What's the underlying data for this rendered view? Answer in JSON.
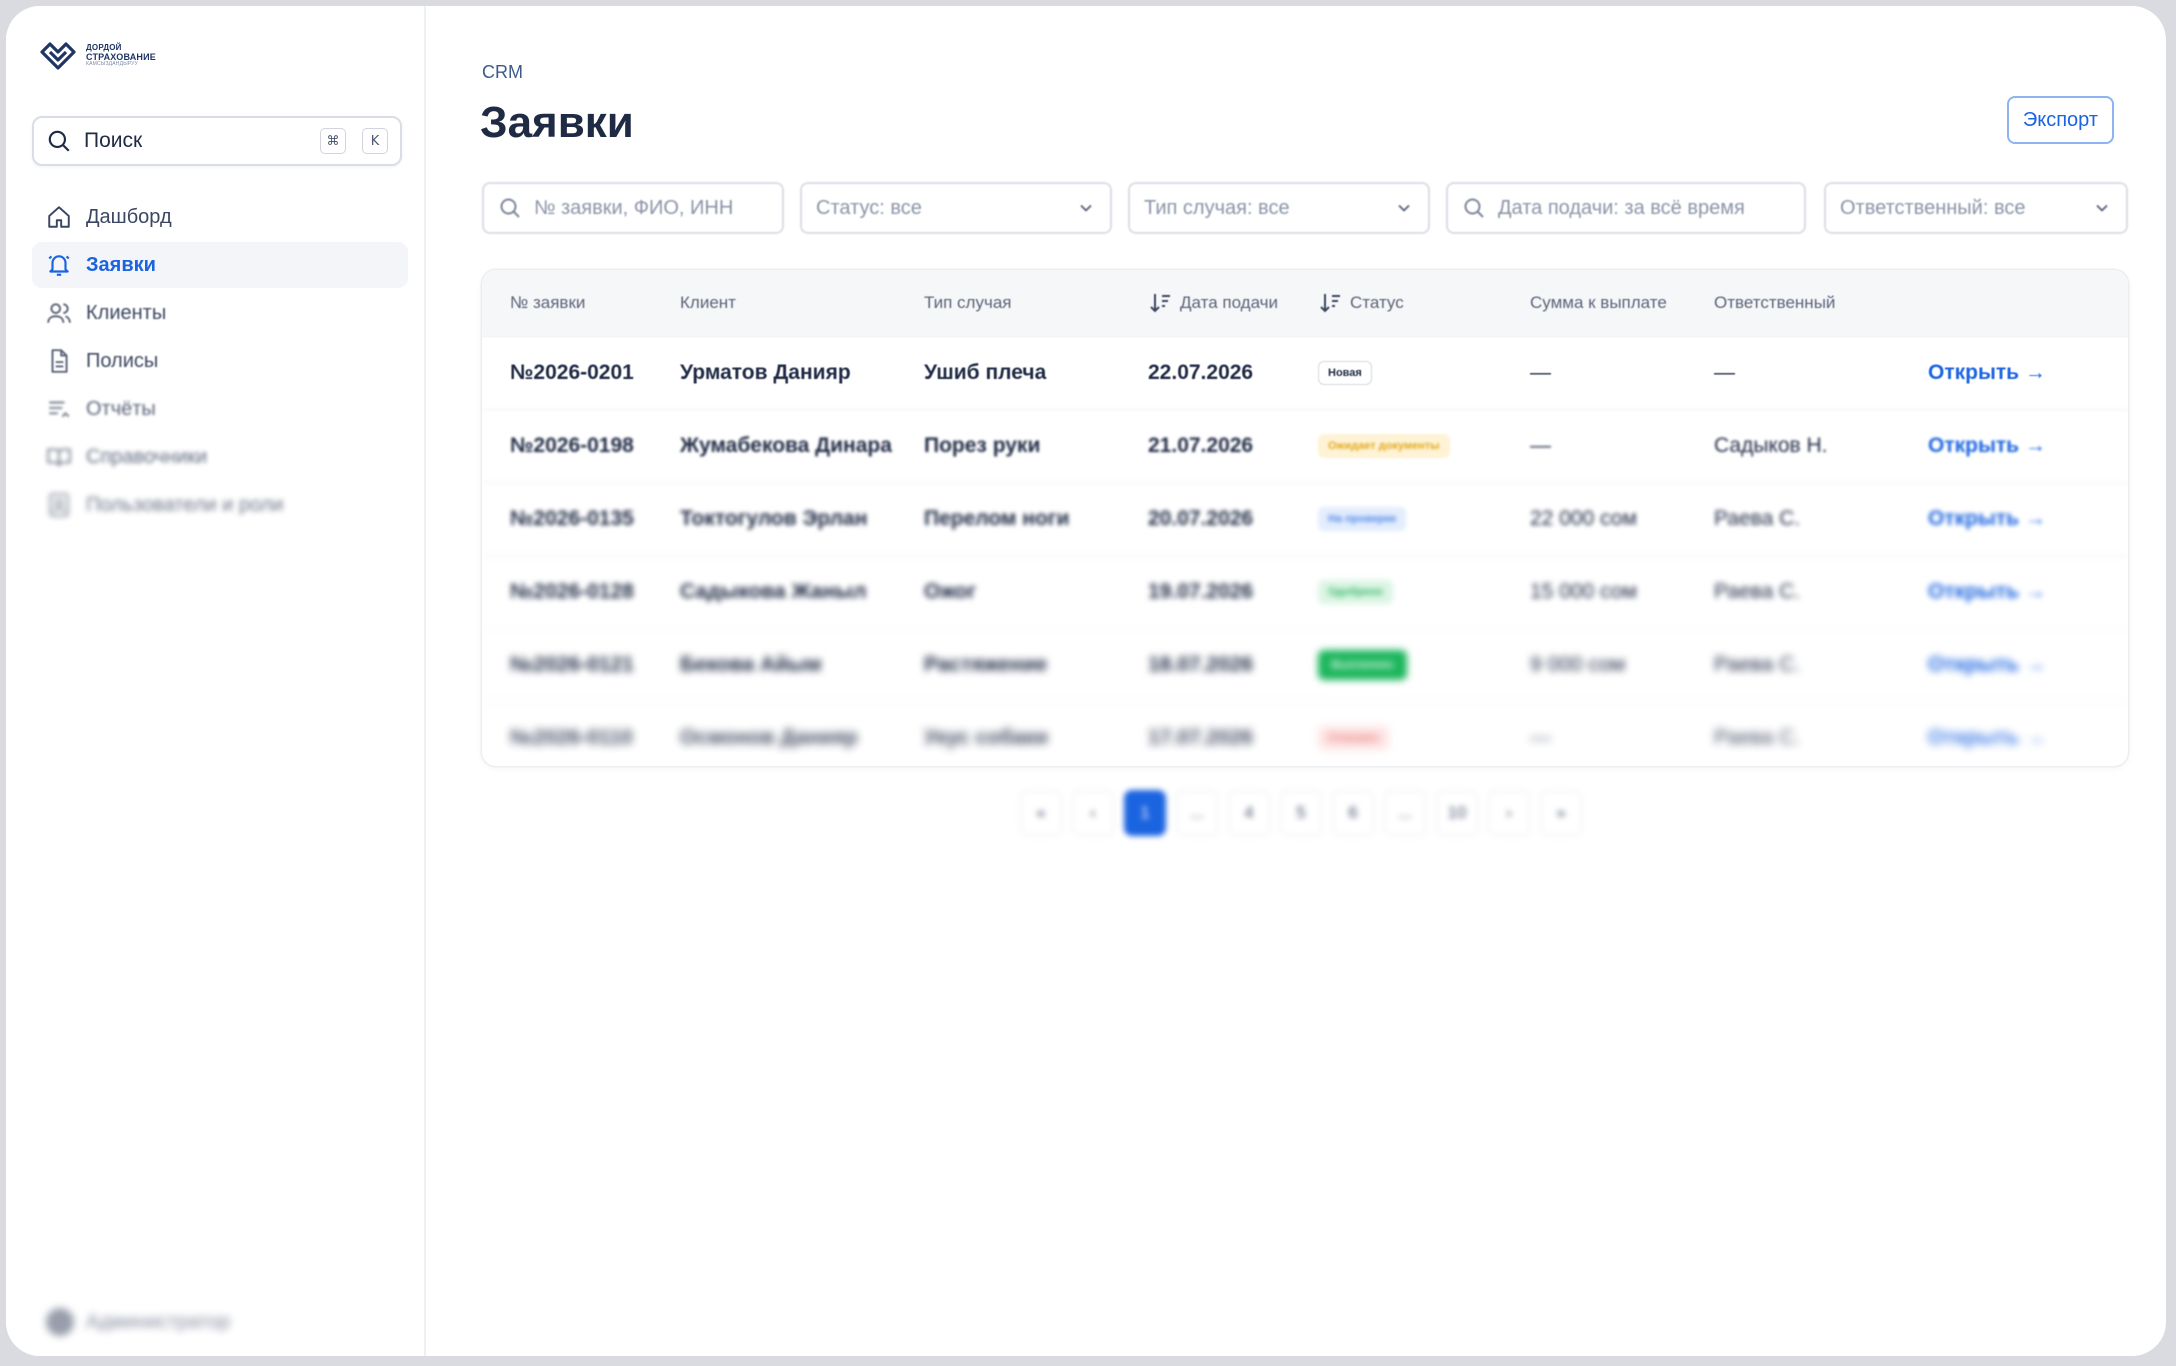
{
  "colors": {
    "accent": "#1b64e0",
    "text": "#1f2a44",
    "muted": "#8a93a6"
  },
  "brand": {
    "line1": "ДОРДОЙ",
    "line2": "СТРАХОВАНИЕ",
    "line3": "КАМСЫЗДАНДЫРУУ",
    "icon": "logo-mark-icon"
  },
  "sidebar": {
    "search": {
      "label": "Поиск",
      "kbd1": "⌘",
      "kbd2": "K"
    },
    "items": [
      {
        "label": "Дашборд",
        "icon": "home-icon"
      },
      {
        "label": "Заявки",
        "icon": "bell-icon",
        "active": true
      },
      {
        "label": "Клиенты",
        "icon": "users-icon"
      },
      {
        "label": "Полисы",
        "icon": "document-icon"
      },
      {
        "label": "Отчёты",
        "icon": "list-icon"
      },
      {
        "label": "Справочники",
        "icon": "book-icon"
      },
      {
        "label": "Пользователи и роли",
        "icon": "id-card-icon"
      }
    ],
    "user": {
      "name": "Администратор"
    }
  },
  "header": {
    "breadcrumb": "CRM",
    "title": "Заявки",
    "export_label": "Экспорт"
  },
  "filters": {
    "search_placeholder": "№ заявки, ФИО, ИНН",
    "status": "Статус: все",
    "case_type": "Тип случая: все",
    "date": "Дата подачи: за всё время",
    "responsible": "Ответственный: все"
  },
  "table": {
    "columns": {
      "id": "№ заявки",
      "client": "Клиент",
      "case": "Тип случая",
      "date": "Дата подачи",
      "status": "Статус",
      "sum": "Сумма к выплате",
      "responsible": "Ответственный"
    },
    "rows": [
      {
        "id": "№2026-0201",
        "client": "Урматов Данияр",
        "case": "Ушиб плеча",
        "date": "22.07.2026",
        "status": "Новая",
        "sum": "—",
        "responsible": "—",
        "open": "Открыть →"
      },
      {
        "id": "№2026-0198",
        "client": "Жумабекова Динара",
        "case": "Порез руки",
        "date": "21.07.2026",
        "status": "Ожидает документы",
        "sum": "—",
        "responsible": "Садыков Н.",
        "open": "Открыть →"
      },
      {
        "id": "№2026-0135",
        "client": "Токтогулов Эрлан",
        "case": "Перелом ноги",
        "date": "20.07.2026",
        "status": "На проверке",
        "sum": "22 000 сом",
        "responsible": "Раева С.",
        "open": "Открыть →"
      },
      {
        "id": "№2026-0128",
        "client": "Садыкова Жаныл",
        "case": "Ожог",
        "date": "19.07.2026",
        "status": "Одобрено",
        "sum": "15 000 сом",
        "responsible": "Раева С.",
        "open": "Открыть →"
      },
      {
        "id": "№2026-0121",
        "client": "Бекова Айым",
        "case": "Растяжение",
        "date": "18.07.2026",
        "status": "Выплачено",
        "sum": "9 000 сом",
        "responsible": "Раева С.",
        "open": "Открыть →"
      },
      {
        "id": "№2026-0110",
        "client": "Осмонов Данияр",
        "case": "Укус собаки",
        "date": "17.07.2026",
        "status": "Отказано",
        "sum": "—",
        "responsible": "Раева С.",
        "open": "Открыть →"
      }
    ]
  },
  "pagination": {
    "first": "«",
    "prev": "‹",
    "pages": [
      "1",
      "...",
      "4",
      "5",
      "6",
      "...",
      "10"
    ],
    "next": "›",
    "last": "»"
  }
}
